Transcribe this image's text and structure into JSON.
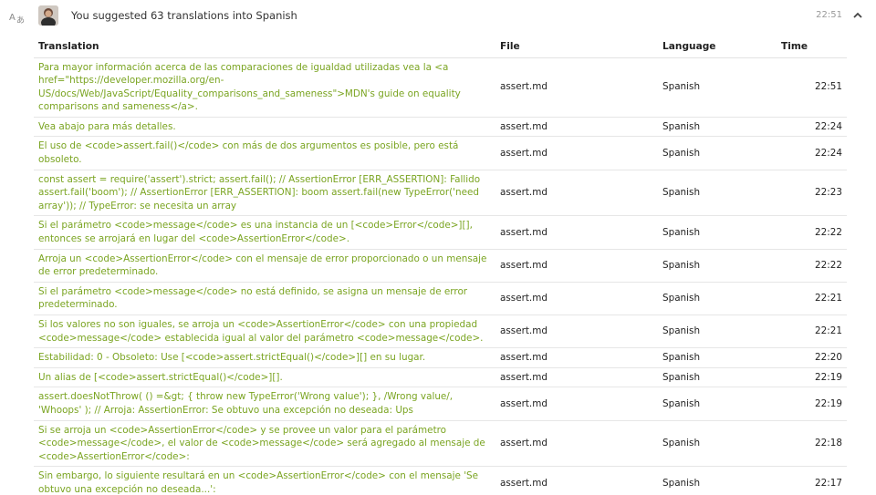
{
  "activity": {
    "title": "You suggested 63 translations into Spanish",
    "time": "22:51"
  },
  "icons": {
    "translate": "translate-icon",
    "collapse": "chevron-up-icon"
  },
  "table": {
    "headers": {
      "translation": "Translation",
      "file": "File",
      "language": "Language",
      "time": "Time"
    },
    "rows": [
      {
        "translation": "Para mayor información acerca de las comparaciones de igualdad utilizadas vea la <a href=\"https://developer.mozilla.org/en-US/docs/Web/JavaScript/Equality_comparisons_and_sameness\">MDN's guide on equality comparisons and sameness</a>.",
        "file": "assert.md",
        "language": "Spanish",
        "time": "22:51"
      },
      {
        "translation": "Vea abajo para más detalles.",
        "file": "assert.md",
        "language": "Spanish",
        "time": "22:24"
      },
      {
        "translation": "El uso de <code>assert.fail()</code> con más de dos argumentos es posible, pero está obsoleto.",
        "file": "assert.md",
        "language": "Spanish",
        "time": "22:24"
      },
      {
        "translation": "const assert = require('assert').strict; assert.fail(); // AssertionError [ERR_ASSERTION]: Fallido assert.fail('boom'); // AssertionError [ERR_ASSERTION]: boom assert.fail(new TypeError('need array')); // TypeError: se necesita un array",
        "file": "assert.md",
        "language": "Spanish",
        "time": "22:23"
      },
      {
        "translation": "Si el parámetro <code>message</code> es una instancia de un [<code>Error</code>][], entonces se arrojará en lugar del <code>AssertionError</code>.",
        "file": "assert.md",
        "language": "Spanish",
        "time": "22:22"
      },
      {
        "translation": "Arroja un <code>AssertionError</code> con el mensaje de error proporcionado o un mensaje de error predeterminado.",
        "file": "assert.md",
        "language": "Spanish",
        "time": "22:22"
      },
      {
        "translation": "Si el parámetro <code>message</code> no está definido, se asigna un mensaje de error predeterminado.",
        "file": "assert.md",
        "language": "Spanish",
        "time": "22:21"
      },
      {
        "translation": "Si los valores no son iguales, se arroja un <code>AssertionError</code> con una propiedad <code>message</code> establecida igual al valor del parámetro <code>message</code>.",
        "file": "assert.md",
        "language": "Spanish",
        "time": "22:21"
      },
      {
        "translation": "Estabilidad: 0 - Obsoleto: Use [<code>assert.strictEqual()</code>][] en su lugar.",
        "file": "assert.md",
        "language": "Spanish",
        "time": "22:20"
      },
      {
        "translation": "Un alias de [<code>assert.strictEqual()</code>][].",
        "file": "assert.md",
        "language": "Spanish",
        "time": "22:19"
      },
      {
        "translation": "assert.doesNotThrow( () =&gt; { throw new TypeError('Wrong value'); }, /Wrong value/, 'Whoops' ); // Arroja: AssertionError: Se obtuvo una excepción no deseada: Ups",
        "file": "assert.md",
        "language": "Spanish",
        "time": "22:19"
      },
      {
        "translation": "Si se arroja un <code>AssertionError</code> y se provee un valor para el parámetro <code>message</code>, el valor de <code>message</code> será agregado al mensaje de <code>AssertionError</code>:",
        "file": "assert.md",
        "language": "Spanish",
        "time": "22:18"
      },
      {
        "translation": "Sin embargo, lo siguiente resultará en un <code>AssertionError</code> con el mensaje 'Se obtuvo una excepción no deseada...':",
        "file": "assert.md",
        "language": "Spanish",
        "time": "22:17"
      }
    ]
  }
}
